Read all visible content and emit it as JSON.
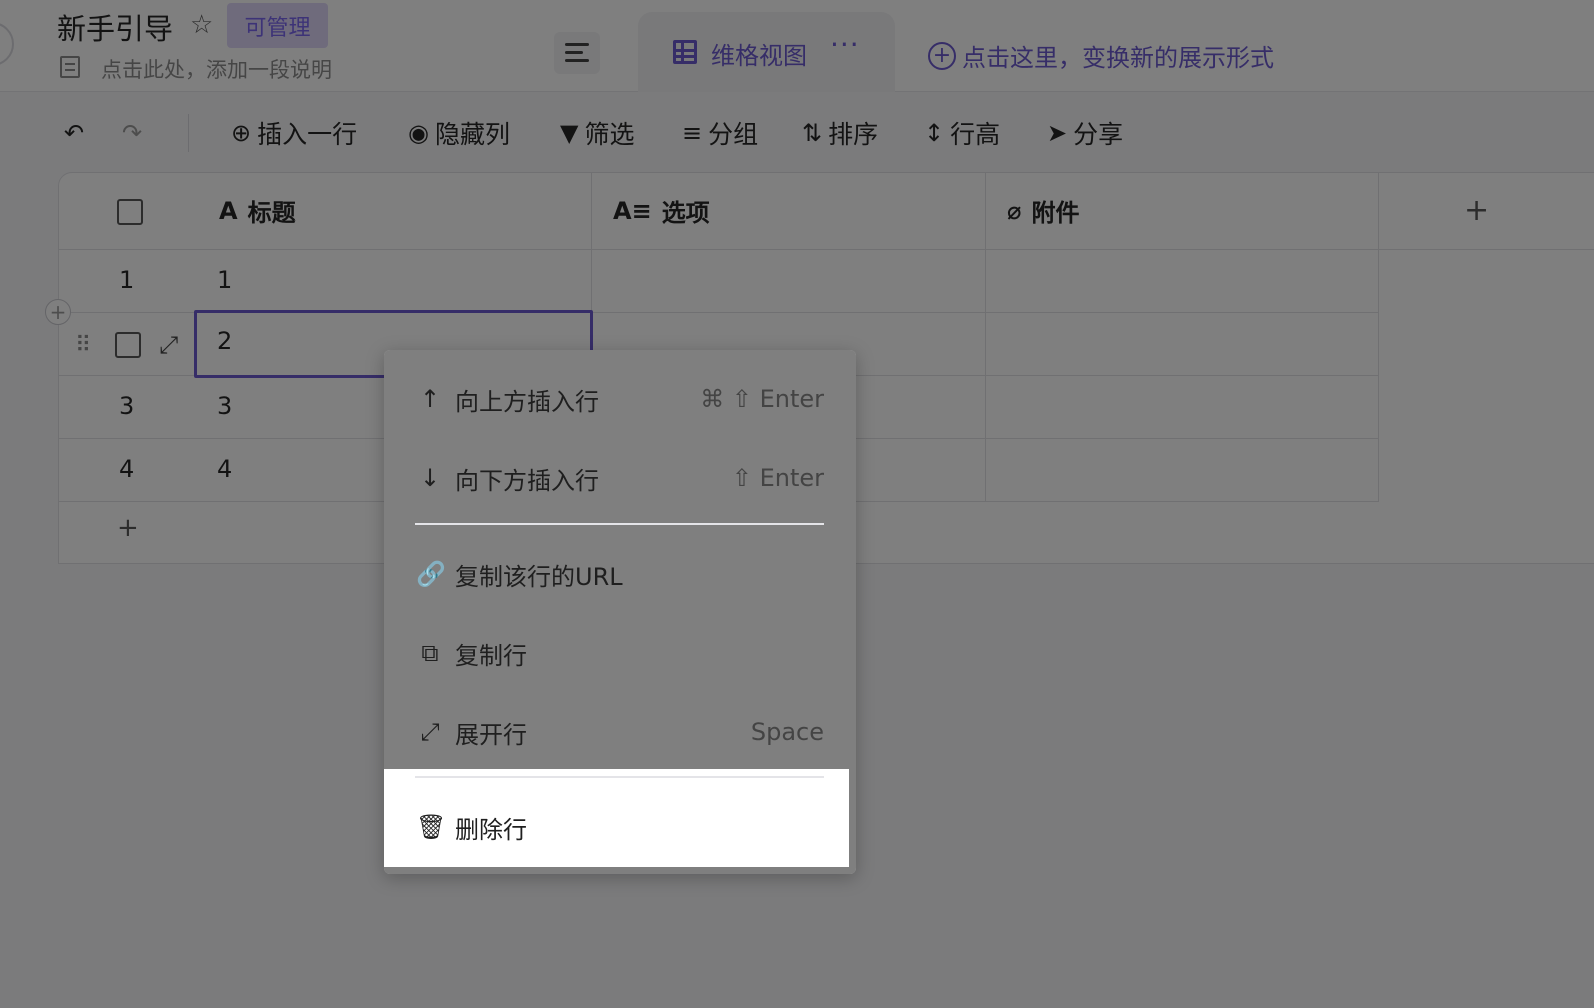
{
  "header": {
    "title": "新手引导",
    "badge": "可管理",
    "description": "点击此处，添加一段说明",
    "view_tab": {
      "label": "维格视图",
      "more": "···"
    },
    "add_view": {
      "plus": "+",
      "label": "点击这里，变换新的展示形式"
    }
  },
  "toolbar": {
    "undo": "↶",
    "redo": "↷",
    "insert_row": "插入一行",
    "hide_columns": "隐藏列",
    "filter": "筛选",
    "group": "分组",
    "sort": "排序",
    "row_height": "行高",
    "share": "分享"
  },
  "grid": {
    "columns": [
      {
        "icon": "A",
        "label": "标题"
      },
      {
        "icon": "A≡",
        "label": "选项"
      },
      {
        "icon": "⌀",
        "label": "附件"
      }
    ],
    "add_column": "+",
    "rows": [
      {
        "num": "1",
        "title": "1"
      },
      {
        "num": "",
        "title": "2"
      },
      {
        "num": "3",
        "title": "3"
      },
      {
        "num": "4",
        "title": "4"
      }
    ],
    "add_row": "+",
    "row_add_circle": "+",
    "drag_handle": "⠿",
    "expand": "⤢"
  },
  "context_menu": {
    "items": [
      {
        "icon": "↑",
        "label": "向上方插入行",
        "shortcut": "⌘ ⇧ Enter"
      },
      {
        "icon": "↓",
        "label": "向下方插入行",
        "shortcut": "⇧ Enter"
      },
      {
        "icon": "🔗",
        "label": "复制该行的URL",
        "shortcut": ""
      },
      {
        "icon": "⧉",
        "label": "复制行",
        "shortcut": ""
      },
      {
        "icon": "⤢",
        "label": "展开行",
        "shortcut": "Space"
      },
      {
        "icon": "🗑",
        "label": "删除行",
        "shortcut": ""
      }
    ]
  }
}
